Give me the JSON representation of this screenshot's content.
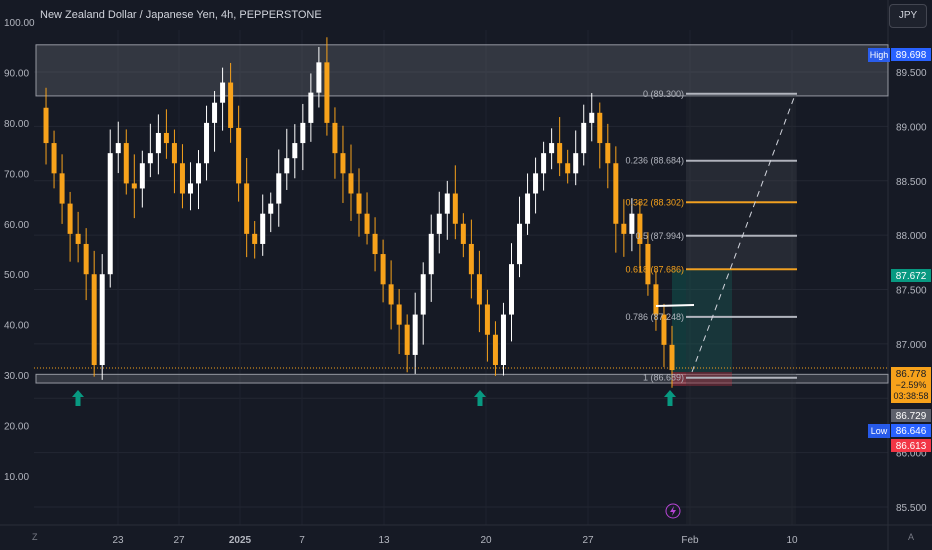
{
  "chart_title": "New Zealand Dollar / Japanese Yen, 4h, PEPPERSTONE",
  "currency_button": "JPY",
  "corner_left": "Z",
  "corner_right": "A",
  "colors": {
    "background": "#161a25",
    "candle_up": "#ffffff",
    "candle_down": "#f7a21b",
    "fib_orange": "#f7a21b",
    "fib_gray": "#b2b5be",
    "green_marker": "#089981",
    "high_label": "#2962ff",
    "low_label": "#2962ff",
    "red_label": "#f23645"
  },
  "chart_data": {
    "type": "candlestick",
    "title": "New Zealand Dollar / Japanese Yen, 4h, PEPPERSTONE",
    "price_axis": {
      "ticks": [
        "89.500",
        "89.000",
        "88.500",
        "88.000",
        "87.500",
        "87.000",
        "86.500",
        "86.000",
        "85.500"
      ],
      "range": [
        85.4,
        89.9
      ]
    },
    "left_axis": {
      "ticks": [
        "100.00",
        "90.00",
        "80.00",
        "70.00",
        "60.00",
        "50.00",
        "40.00",
        "30.00",
        "20.00",
        "10.00"
      ],
      "range": [
        0,
        100
      ]
    },
    "x_axis_ticks": [
      "23",
      "27",
      "2025",
      "7",
      "13",
      "20",
      "27",
      "Feb",
      "10"
    ],
    "close_path": [
      83,
      76,
      70,
      64,
      58,
      56,
      50,
      32,
      50,
      74,
      76,
      68,
      67,
      72,
      74,
      78,
      76,
      72,
      66,
      68,
      72,
      80,
      84,
      88,
      79,
      68,
      58,
      56,
      62,
      64,
      70,
      73,
      76,
      80,
      86,
      92,
      80,
      74,
      70,
      66,
      62,
      58,
      54,
      48,
      44,
      40,
      34,
      42,
      50,
      58,
      62,
      66,
      60,
      56,
      50,
      44,
      38,
      32,
      42,
      52,
      60,
      66,
      70,
      74,
      76,
      72,
      70,
      74,
      80,
      82,
      76,
      72,
      60,
      58,
      62,
      56,
      48,
      42,
      36,
      31
    ],
    "price_badges": [
      {
        "text": "High",
        "value": "89.698"
      },
      {
        "text": "",
        "value": "87.672"
      },
      {
        "text": "",
        "value": "86.778",
        "change": "−2.59%",
        "timer": "03:38:58"
      },
      {
        "text": "",
        "value": "86.729"
      },
      {
        "text": "Low",
        "value": "86.646"
      },
      {
        "text": "",
        "value": "86.613"
      }
    ],
    "fib_levels": [
      {
        "label": "0 (89.300)",
        "ratio": 0,
        "price": 89.3,
        "color": "gray"
      },
      {
        "label": "0.236 (88.684)",
        "ratio": 0.236,
        "price": 88.684,
        "color": "gray"
      },
      {
        "label": "0.382 (88.302)",
        "ratio": 0.382,
        "price": 88.302,
        "color": "orange"
      },
      {
        "label": "0.5 (87.994)",
        "ratio": 0.5,
        "price": 87.994,
        "color": "gray"
      },
      {
        "label": "0.618 (87.686)",
        "ratio": 0.618,
        "price": 87.686,
        "color": "orange"
      },
      {
        "label": "0.786 (87.248)",
        "ratio": 0.786,
        "price": 87.248,
        "color": "gray"
      },
      {
        "label": "1 (86.689)",
        "ratio": 1,
        "price": 86.689,
        "color": "gray"
      }
    ],
    "zones": [
      {
        "name": "resistance",
        "top_price": 89.75,
        "bottom_price": 89.28
      },
      {
        "name": "support",
        "top_price": 86.72,
        "bottom_price": 86.64
      }
    ],
    "markers": [
      {
        "type": "arrow-up",
        "x_tick": "23"
      },
      {
        "type": "arrow-up",
        "x_tick": "20"
      },
      {
        "type": "arrow-up",
        "x_tick": "27"
      }
    ]
  }
}
